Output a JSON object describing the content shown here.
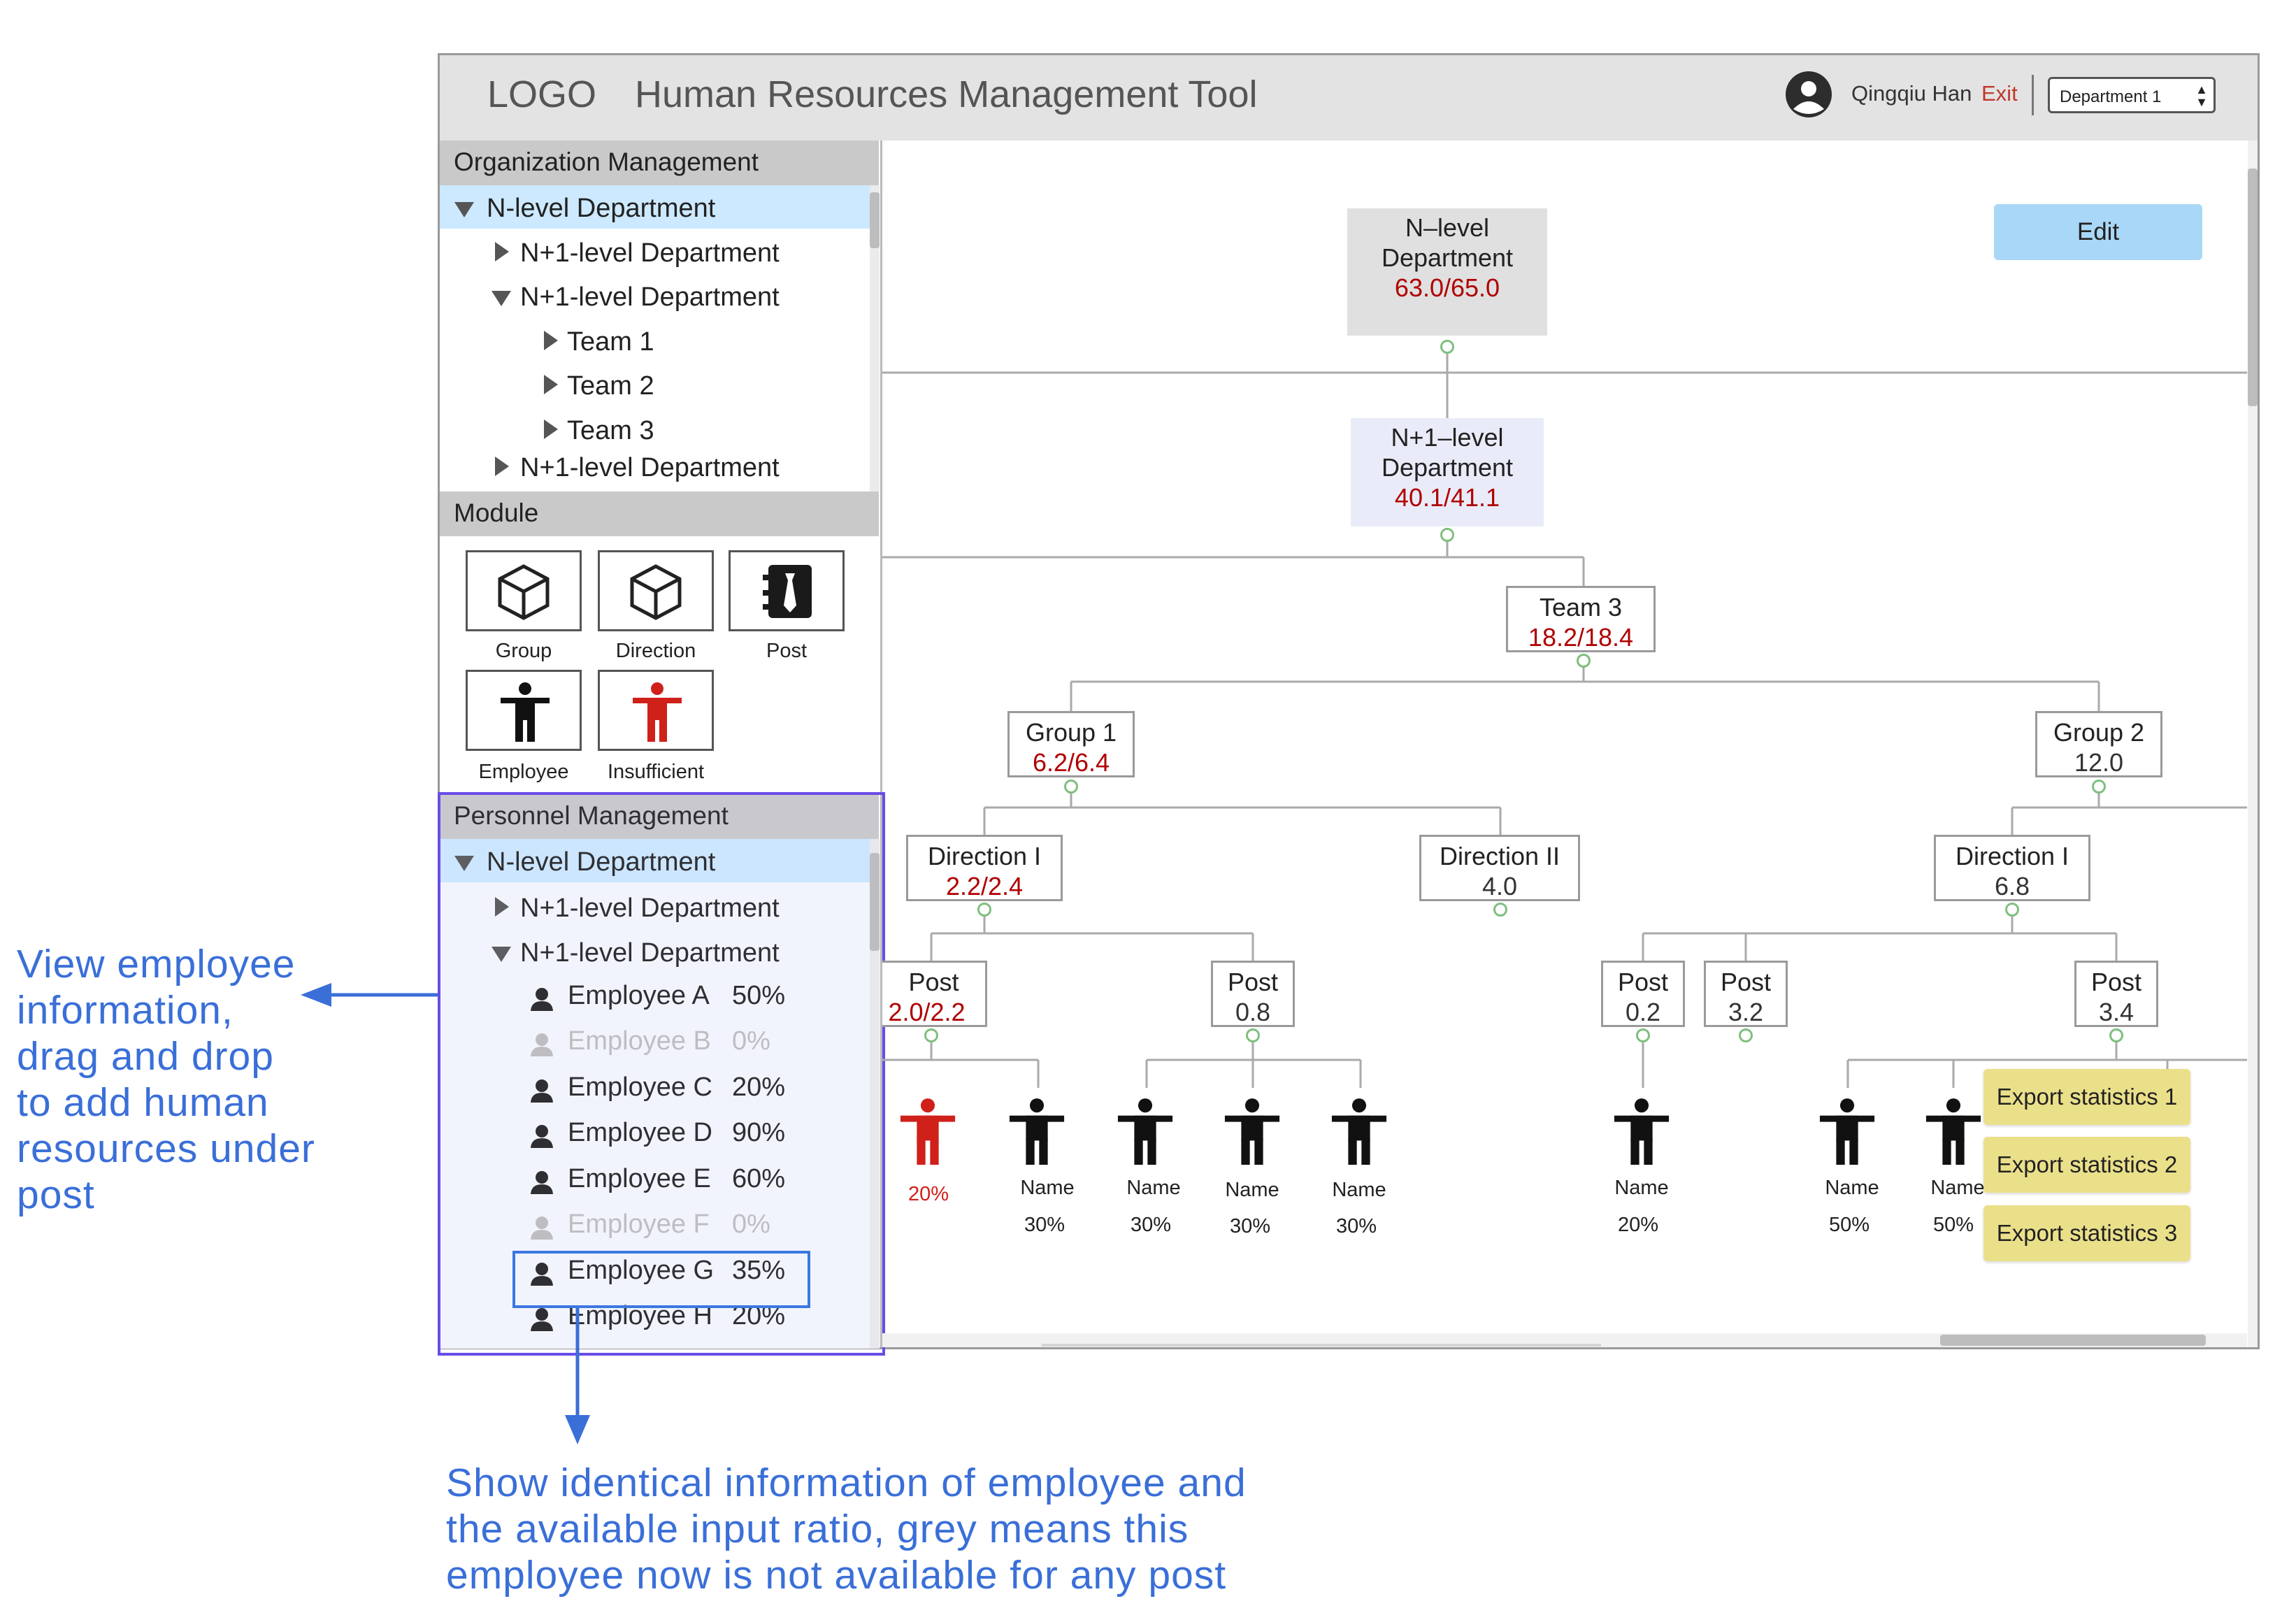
{
  "header": {
    "logo": "LOGO",
    "title": "Human Resources Management Tool",
    "user_name": "Qingqiu Han",
    "exit_label": "Exit",
    "department_select": "Department 1"
  },
  "org_management": {
    "title": "Organization Management",
    "items": [
      {
        "label": "N-level Department",
        "state": "expanded",
        "selected": true
      },
      {
        "label": "N+1-level Department",
        "state": "collapsed"
      },
      {
        "label": "N+1-level Department",
        "state": "expanded"
      },
      {
        "label": "Team 1",
        "state": "collapsed"
      },
      {
        "label": "Team 2",
        "state": "collapsed"
      },
      {
        "label": "Team 3",
        "state": "collapsed"
      },
      {
        "label": "N+1-level Department",
        "state": "collapsed"
      }
    ]
  },
  "module": {
    "title": "Module",
    "items": [
      {
        "label": "Group",
        "icon": "cube-icon"
      },
      {
        "label": "Direction",
        "icon": "cube-icon"
      },
      {
        "label": "Post",
        "icon": "post-icon"
      },
      {
        "label": "Employee",
        "icon": "person-icon"
      },
      {
        "label": "Insufficient",
        "icon": "person-red-icon"
      }
    ]
  },
  "personnel_management": {
    "title": "Personnel Management",
    "tree": [
      {
        "label": "N-level Department",
        "state": "expanded",
        "selected": true
      },
      {
        "label": "N+1-level Department",
        "state": "collapsed"
      },
      {
        "label": "N+1-level Department",
        "state": "expanded"
      }
    ],
    "employees": [
      {
        "name": "Employee A",
        "ratio": "50%",
        "available": true
      },
      {
        "name": "Employee B",
        "ratio": "0%",
        "available": false
      },
      {
        "name": "Employee C",
        "ratio": "20%",
        "available": true
      },
      {
        "name": "Employee D",
        "ratio": "90%",
        "available": true
      },
      {
        "name": "Employee E",
        "ratio": "60%",
        "available": true
      },
      {
        "name": "Employee F",
        "ratio": "0%",
        "available": false
      },
      {
        "name": "Employee G",
        "ratio": "35%",
        "available": true
      },
      {
        "name": "Employee H",
        "ratio": "20%",
        "available": true
      }
    ]
  },
  "diagram": {
    "edit_label": "Edit",
    "nodes": {
      "n_level": {
        "l1": "N–level",
        "l2": "Department",
        "value": "63.0/65.0"
      },
      "n1_level": {
        "l1": "N+1–level",
        "l2": "Department",
        "value": "40.1/41.1"
      },
      "team3": {
        "label": "Team 3",
        "value": "18.2/18.4"
      },
      "group1": {
        "label": "Group 1",
        "value": "6.2/6.4"
      },
      "group2": {
        "label": "Group 2",
        "value": "12.0"
      },
      "dir1_g1": {
        "label": "Direction I",
        "value": "2.2/2.4"
      },
      "dir2_g1": {
        "label": "Direction II",
        "value": "4.0"
      },
      "dir1_g2": {
        "label": "Direction I",
        "value": "6.8"
      },
      "post_a": {
        "label": "Post",
        "value": "2.0/2.2"
      },
      "post_b": {
        "label": "Post",
        "value": "0.8"
      },
      "post_c": {
        "label": "Post",
        "value": "0.2"
      },
      "post_d": {
        "label": "Post",
        "value": "3.2"
      },
      "post_e": {
        "label": "Post",
        "value": "3.4"
      }
    },
    "people": [
      {
        "name": "",
        "ratio": "20%",
        "insufficient": true
      },
      {
        "name": "Name",
        "ratio": "30%"
      },
      {
        "name": "Name",
        "ratio": "30%"
      },
      {
        "name": "Name",
        "ratio": "30%"
      },
      {
        "name": "Name",
        "ratio": "30%"
      },
      {
        "name": "Name",
        "ratio": "20%"
      },
      {
        "name": "Name",
        "ratio": "50%"
      },
      {
        "name": "Name",
        "ratio": "50%"
      }
    ],
    "export_menu": [
      "Export statistics 1",
      "Export statistics 2",
      "Export statistics 3"
    ]
  },
  "annotations": {
    "left_lines": [
      "View employee",
      "information,",
      "drag and drop",
      "to add human",
      "resources under",
      "post"
    ],
    "bottom_lines": [
      "Show identical information of employee and",
      "the available input ratio, grey means this",
      "employee now is not available for any post"
    ]
  },
  "colors": {
    "accent_blue": "#3a6fd8",
    "value_red": "#b00000",
    "insufficient_red": "#d0201a",
    "selection_bg": "#cce9ff",
    "edit_button": "#a9d7f7",
    "export_button": "#ebe08a",
    "highlight_purple": "#6a4ce8"
  }
}
